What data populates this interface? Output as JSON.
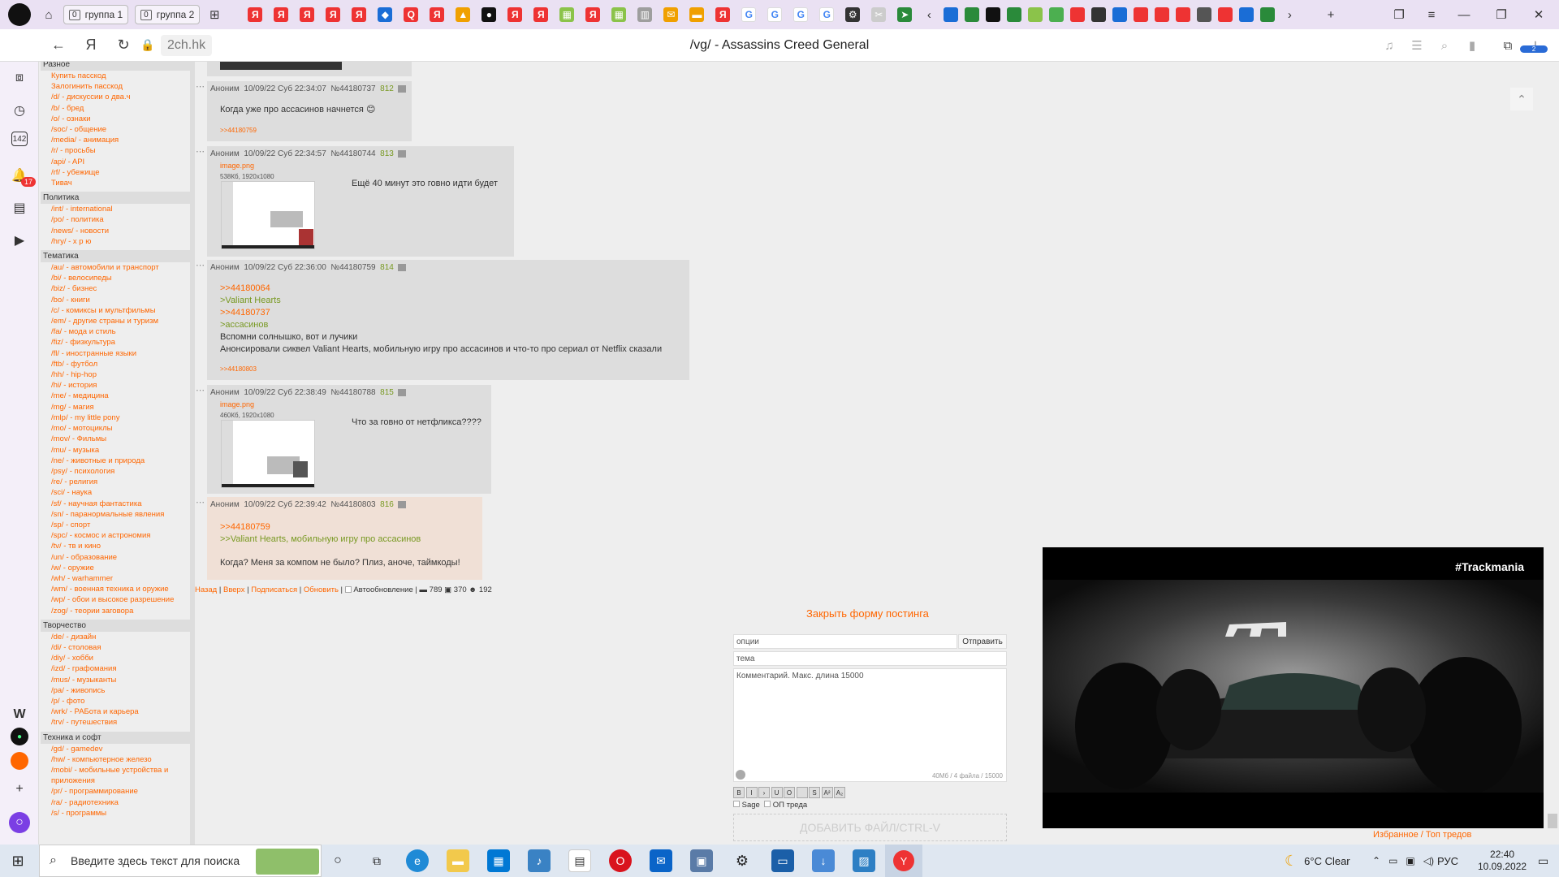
{
  "browser": {
    "tab_groups": [
      {
        "count": "0",
        "label": "группа 1"
      },
      {
        "count": "0",
        "label": "группа 2"
      }
    ],
    "domain": "2ch.hk",
    "page_title": "/vg/ - Assassins Creed General",
    "downloads_badge": "2",
    "notifications_badge": "17",
    "sidebar_count": "142"
  },
  "boardnav": [
    {
      "category": "Разное",
      "boards": [
        "Купить пасскод",
        "Залогинить пасскод",
        "/d/ - дискуссии о два.ч",
        "/b/ - бред",
        "/o/ - ознаки",
        "/soc/ - общение",
        "/media/ - анимация",
        "/r/ - просьбы",
        "/api/ - API",
        "/rf/ - убежище",
        "Тивач"
      ]
    },
    {
      "category": "Политика",
      "boards": [
        "/int/ - international",
        "/po/ - политика",
        "/news/ - новости",
        "/hry/ - х р ю"
      ]
    },
    {
      "category": "Тематика",
      "boards": [
        "/au/ - автомобили и транспорт",
        "/bi/ - велосипеды",
        "/biz/ - бизнес",
        "/bo/ - книги",
        "/c/ - комиксы и мультфильмы",
        "/em/ - другие страны и туризм",
        "/fa/ - мода и стиль",
        "/fiz/ - физкультура",
        "/fl/ - иностранные языки",
        "/ftb/ - футбол",
        "/hh/ - hip-hop",
        "/hi/ - история",
        "/me/ - медицина",
        "/mg/ - магия",
        "/mlp/ - my little pony",
        "/mo/ - мотоциклы",
        "/mov/ - Фильмы",
        "/mu/ - музыка",
        "/ne/ - животные и природа",
        "/psy/ - психология",
        "/re/ - религия",
        "/sci/ - наука",
        "/sf/ - научная фантастика",
        "/sn/ - паранормальные явления",
        "/sp/ - спорт",
        "/spc/ - космос и астрономия",
        "/tv/ - тв и кино",
        "/un/ - образование",
        "/w/ - оружие",
        "/wh/ - warhammer",
        "/wm/ - военная техника и оружие",
        "/wp/ - обои и высокое разрешение",
        "/zog/ - теории заговора"
      ]
    },
    {
      "category": "Творчество",
      "boards": [
        "/de/ - дизайн",
        "/di/ - столовая",
        "/diy/ - хобби",
        "/izd/ - графомания",
        "/mus/ - музыканты",
        "/pa/ - живопись",
        "/p/ - фото",
        "/wrk/ - РАБота и карьера",
        "/trv/ - путешествия"
      ]
    },
    {
      "category": "Техника и софт",
      "boards": [
        "/gd/ - gamedev",
        "/hw/ - компьютерное железо",
        "/mobi/ - мобильные устройства и",
        "приложения",
        "/pr/ - программирование",
        "/ra/ - радиотехника",
        "/s/ - программы"
      ]
    }
  ],
  "posts": [
    {
      "header": {
        "name": "Аноним",
        "date": "10/09/22 Суб 22:34:07",
        "num": "№44180737",
        "pn": "812"
      },
      "text": "Когда уже про ассасинов начнется 😊",
      "reply": ">>44180759"
    },
    {
      "header": {
        "name": "Аноним",
        "date": "10/09/22 Суб 22:34:57",
        "num": "№44180744",
        "pn": "813"
      },
      "file": {
        "name": "image.png",
        "info": "538Кб, 1920x1080"
      },
      "text": "Ещё 40 минут это говно идти будет"
    },
    {
      "header": {
        "name": "Аноним",
        "date": "10/09/22 Суб 22:36:00",
        "num": "№44180759",
        "pn": "814"
      },
      "lines": [
        ">>44180064",
        ">Valiant Hearts",
        ">>44180737",
        ">ассасинов",
        "Вспомни солнышко, вот и лучики",
        "Анонсировали сиквел Valiant Hearts, мобильную игру про ассасинов и что-то про сериал от Netflix сказали"
      ],
      "reply": ">>44180803"
    },
    {
      "header": {
        "name": "Аноним",
        "date": "10/09/22 Суб 22:38:49",
        "num": "№44180788",
        "pn": "815"
      },
      "file": {
        "name": "image.png",
        "info": "460Кб, 1920x1080"
      },
      "text": "Что за говно от нетфликса????"
    },
    {
      "header": {
        "name": "Аноним",
        "date": "10/09/22 Суб 22:39:42",
        "num": "№44180803",
        "pn": "816"
      },
      "lines": [
        ">>44180759",
        ">>Valiant Hearts, мобильную игру про ассасинов",
        "Когда? Меня за компом не было? Плиз, аноче, таймкоды!"
      ]
    }
  ],
  "thread_links": {
    "back": "Назад",
    "up": "Вверх",
    "subscribe": "Подписаться",
    "refresh": "Обновить",
    "autorefresh": "Автообновление",
    "posts": "789",
    "files": "370",
    "users": "192"
  },
  "form": {
    "close": "Закрыть форму постинга",
    "options_placeholder": "опции",
    "send": "Отправить",
    "subject_placeholder": "тема",
    "comment_placeholder": "Комментарий. Макс. длина 15000",
    "limits": "40Мб / 4 файла / 15000",
    "sage": "Sage",
    "op": "ОП треда",
    "addfile": "ДОБАВИТЬ ФАЙЛ/CTRL-V",
    "fmt_buttons": [
      "B",
      "I",
      "›",
      "U",
      "O",
      "",
      "S",
      "A²",
      "A₂"
    ]
  },
  "video": {
    "title": "#Trackmania"
  },
  "favorites": "Избранное / Топ тредов",
  "taskbar": {
    "search_placeholder": "Введите здесь текст для поиска",
    "weather": "6°C  Clear",
    "lang": "РУС",
    "time": "22:40",
    "date": "10.09.2022"
  },
  "colors": {
    "link": "#ff6600",
    "quote": "#789922",
    "post_bg": "#dddddd",
    "op_bg": "#f0e0d6"
  }
}
